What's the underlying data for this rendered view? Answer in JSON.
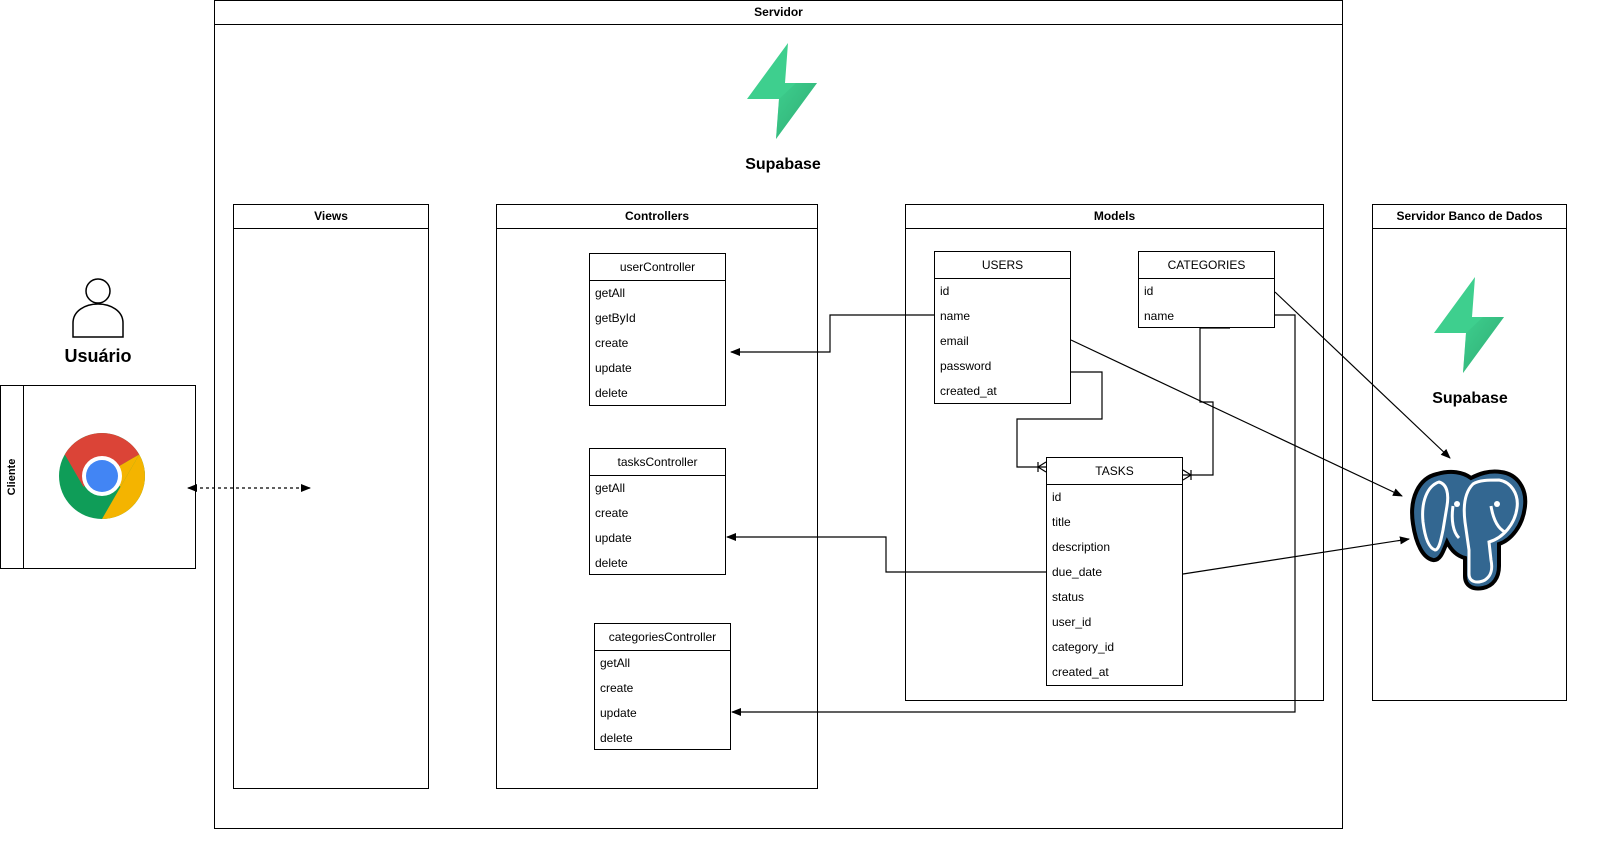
{
  "servidor": {
    "title": "Servidor",
    "brand": "Supabase"
  },
  "cliente": {
    "title": "Cliente"
  },
  "usuario": {
    "label": "Usuário"
  },
  "views": {
    "title": "Views"
  },
  "controllers": {
    "title": "Controllers",
    "items": [
      {
        "name": "userController",
        "methods": [
          "getAll",
          "getById",
          "create",
          "update",
          "delete"
        ]
      },
      {
        "name": "tasksController",
        "methods": [
          "getAll",
          "create",
          "update",
          "delete"
        ]
      },
      {
        "name": "categoriesController",
        "methods": [
          "getAll",
          "create",
          "update",
          "delete"
        ]
      }
    ]
  },
  "models": {
    "title": "Models",
    "entities": [
      {
        "name": "USERS",
        "fields": [
          "id",
          "name",
          "email",
          "password",
          "created_at"
        ]
      },
      {
        "name": "CATEGORIES",
        "fields": [
          "id",
          "name"
        ]
      },
      {
        "name": "TASKS",
        "fields": [
          "id",
          "title",
          "description",
          "due_date",
          "status",
          "user_id",
          "category_id",
          "created_at"
        ]
      }
    ]
  },
  "db_server": {
    "title": "Servidor Banco de Dados",
    "brand": "Supabase"
  },
  "colors": {
    "supabase_green": "#3ECF8E",
    "supabase_green_dark": "#249361",
    "postgres_blue": "#336791",
    "chrome_red": "#DB4437",
    "chrome_yellow": "#F4B400",
    "chrome_green": "#0F9D58",
    "chrome_blue": "#4285F4"
  },
  "icons": [
    "supabase-logo-icon",
    "user-person-icon",
    "chrome-browser-icon",
    "postgresql-elephant-icon"
  ]
}
